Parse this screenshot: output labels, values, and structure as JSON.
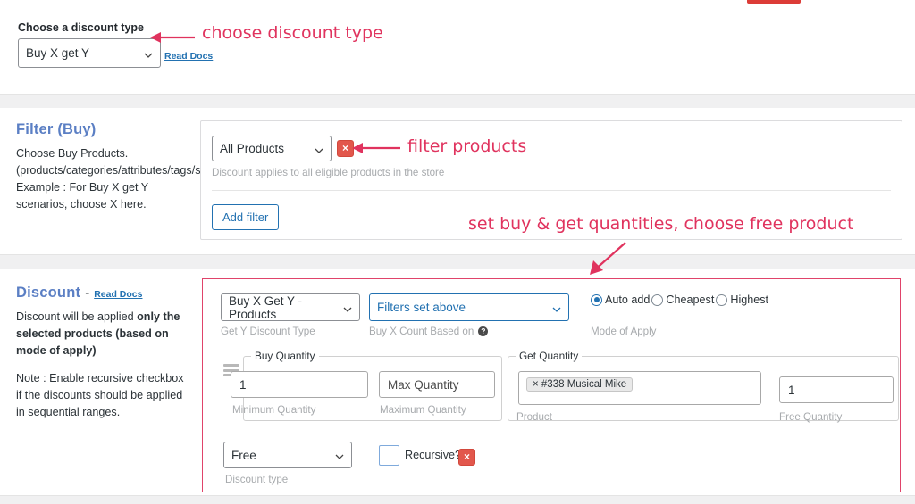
{
  "discount_type_section": {
    "label": "Choose a discount type",
    "select_value": "Buy X get Y",
    "read_docs": "Read Docs"
  },
  "filter_section": {
    "title": "Filter (Buy)",
    "description": "Choose Buy Products. (products/categories/attributes/tags/sku) Example : For Buy X get Y scenarios, choose X here.",
    "filter_select_value": "All Products",
    "remove_label": "×",
    "help_text": "Discount applies to all eligible products in the store",
    "add_filter_label": "Add filter"
  },
  "discount_section": {
    "title": "Discount",
    "title_dash": "-",
    "read_docs": "Read Docs",
    "description_1_plain": "Discount will be applied ",
    "description_1_bold": "only the selected products (based on mode of apply)",
    "description_2": "Note : Enable recursive checkbox if the discounts should be applied in sequential ranges.",
    "get_y_discount_type": {
      "value": "Buy X Get Y - Products",
      "label": "Get Y Discount Type"
    },
    "buy_x_count_based_on": {
      "value": "Filters set above",
      "label": "Buy X Count Based on",
      "info_glyph": "?"
    },
    "mode_of_apply": {
      "label": "Mode of Apply",
      "options": [
        {
          "label": "Auto add",
          "selected": true
        },
        {
          "label": "Cheapest",
          "selected": false
        },
        {
          "label": "Highest",
          "selected": false
        }
      ]
    },
    "buy_quantity": {
      "legend": "Buy Quantity",
      "min_value": "1",
      "min_label": "Minimum Quantity",
      "max_placeholder": "Max Quantity",
      "max_label": "Maximum Quantity"
    },
    "get_quantity": {
      "legend": "Get Quantity",
      "product_chip": "× #338 Musical Mike",
      "product_label": "Product",
      "free_value": "1",
      "free_label": "Free Quantity"
    },
    "discount_type": {
      "value": "Free",
      "label": "Discount type"
    },
    "recursive": {
      "label": "Recursive?",
      "checked": false
    },
    "remove_label": "×"
  },
  "annotations": [
    {
      "text": "choose discount type"
    },
    {
      "text": "filter products"
    },
    {
      "text": "set buy & get quantities, choose free product"
    }
  ],
  "colors": {
    "annotation": "#e0335e",
    "section_title": "#5b7fc4",
    "link": "#2271b1",
    "danger": "#e2574c"
  }
}
